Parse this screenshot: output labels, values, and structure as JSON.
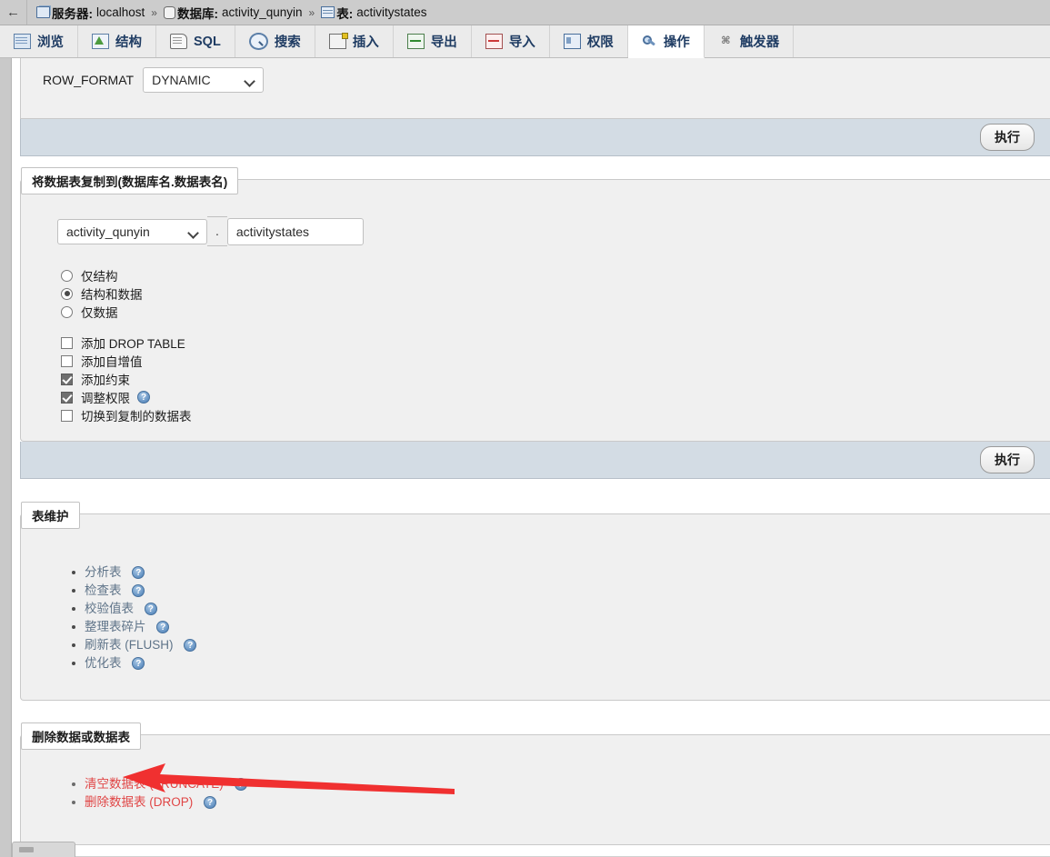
{
  "window": {
    "back_button": "←"
  },
  "breadcrumb": {
    "server_label": "服务器:",
    "server_value": "localhost",
    "sep": "»",
    "database_label": "数据库:",
    "database_value": "activity_qunyin",
    "table_label": "表:",
    "table_value": "activitystates"
  },
  "tabs": [
    {
      "label": "浏览",
      "icon": "browse-icon",
      "active": false
    },
    {
      "label": "结构",
      "icon": "structure-icon",
      "active": false
    },
    {
      "label": "SQL",
      "icon": "sql-icon",
      "active": false
    },
    {
      "label": "搜索",
      "icon": "search-icon",
      "active": false
    },
    {
      "label": "插入",
      "icon": "insert-icon",
      "active": false
    },
    {
      "label": "导出",
      "icon": "export-icon",
      "active": false
    },
    {
      "label": "导入",
      "icon": "import-icon",
      "active": false
    },
    {
      "label": "权限",
      "icon": "privileges-icon",
      "active": false
    },
    {
      "label": "操作",
      "icon": "operations-icon",
      "active": true
    },
    {
      "label": "触发器",
      "icon": "triggers-icon",
      "active": false
    }
  ],
  "table_options": {
    "row_format_label": "ROW_FORMAT",
    "row_format_value": "DYNAMIC",
    "go_label": "执行"
  },
  "copy_table": {
    "legend": "将数据表复制到(数据库名.数据表名)",
    "database_value": "activity_qunyin",
    "dot": ".",
    "table_value": "activitystates",
    "radios": [
      {
        "label": "仅结构",
        "checked": false
      },
      {
        "label": "结构和数据",
        "checked": true
      },
      {
        "label": "仅数据",
        "checked": false
      }
    ],
    "checkboxes": [
      {
        "label": "添加 DROP TABLE",
        "checked": false,
        "help": false
      },
      {
        "label": "添加自增值",
        "checked": false,
        "help": false
      },
      {
        "label": "添加约束",
        "checked": true,
        "help": false
      },
      {
        "label": "调整权限",
        "checked": true,
        "help": true
      },
      {
        "label": "切换到复制的数据表",
        "checked": false,
        "help": false
      }
    ],
    "go_label": "执行"
  },
  "maintenance": {
    "legend": "表维护",
    "items": [
      {
        "label": "分析表",
        "help": true
      },
      {
        "label": "检查表",
        "help": true
      },
      {
        "label": "校验值表",
        "help": true
      },
      {
        "label": "整理表碎片",
        "help": true
      },
      {
        "label": "刷新表 (FLUSH)",
        "help": true
      },
      {
        "label": "优化表",
        "help": true
      }
    ]
  },
  "delete_data": {
    "legend": "删除数据或数据表",
    "items": [
      {
        "label": "清空数据表 (TRUNCATE)",
        "help": true
      },
      {
        "label": "删除数据表 (DROP)",
        "help": true
      }
    ]
  },
  "annotation": {
    "arrow_color": "#f03030",
    "points_at": "清空数据表 (TRUNCATE)"
  },
  "help_glyph": "?"
}
